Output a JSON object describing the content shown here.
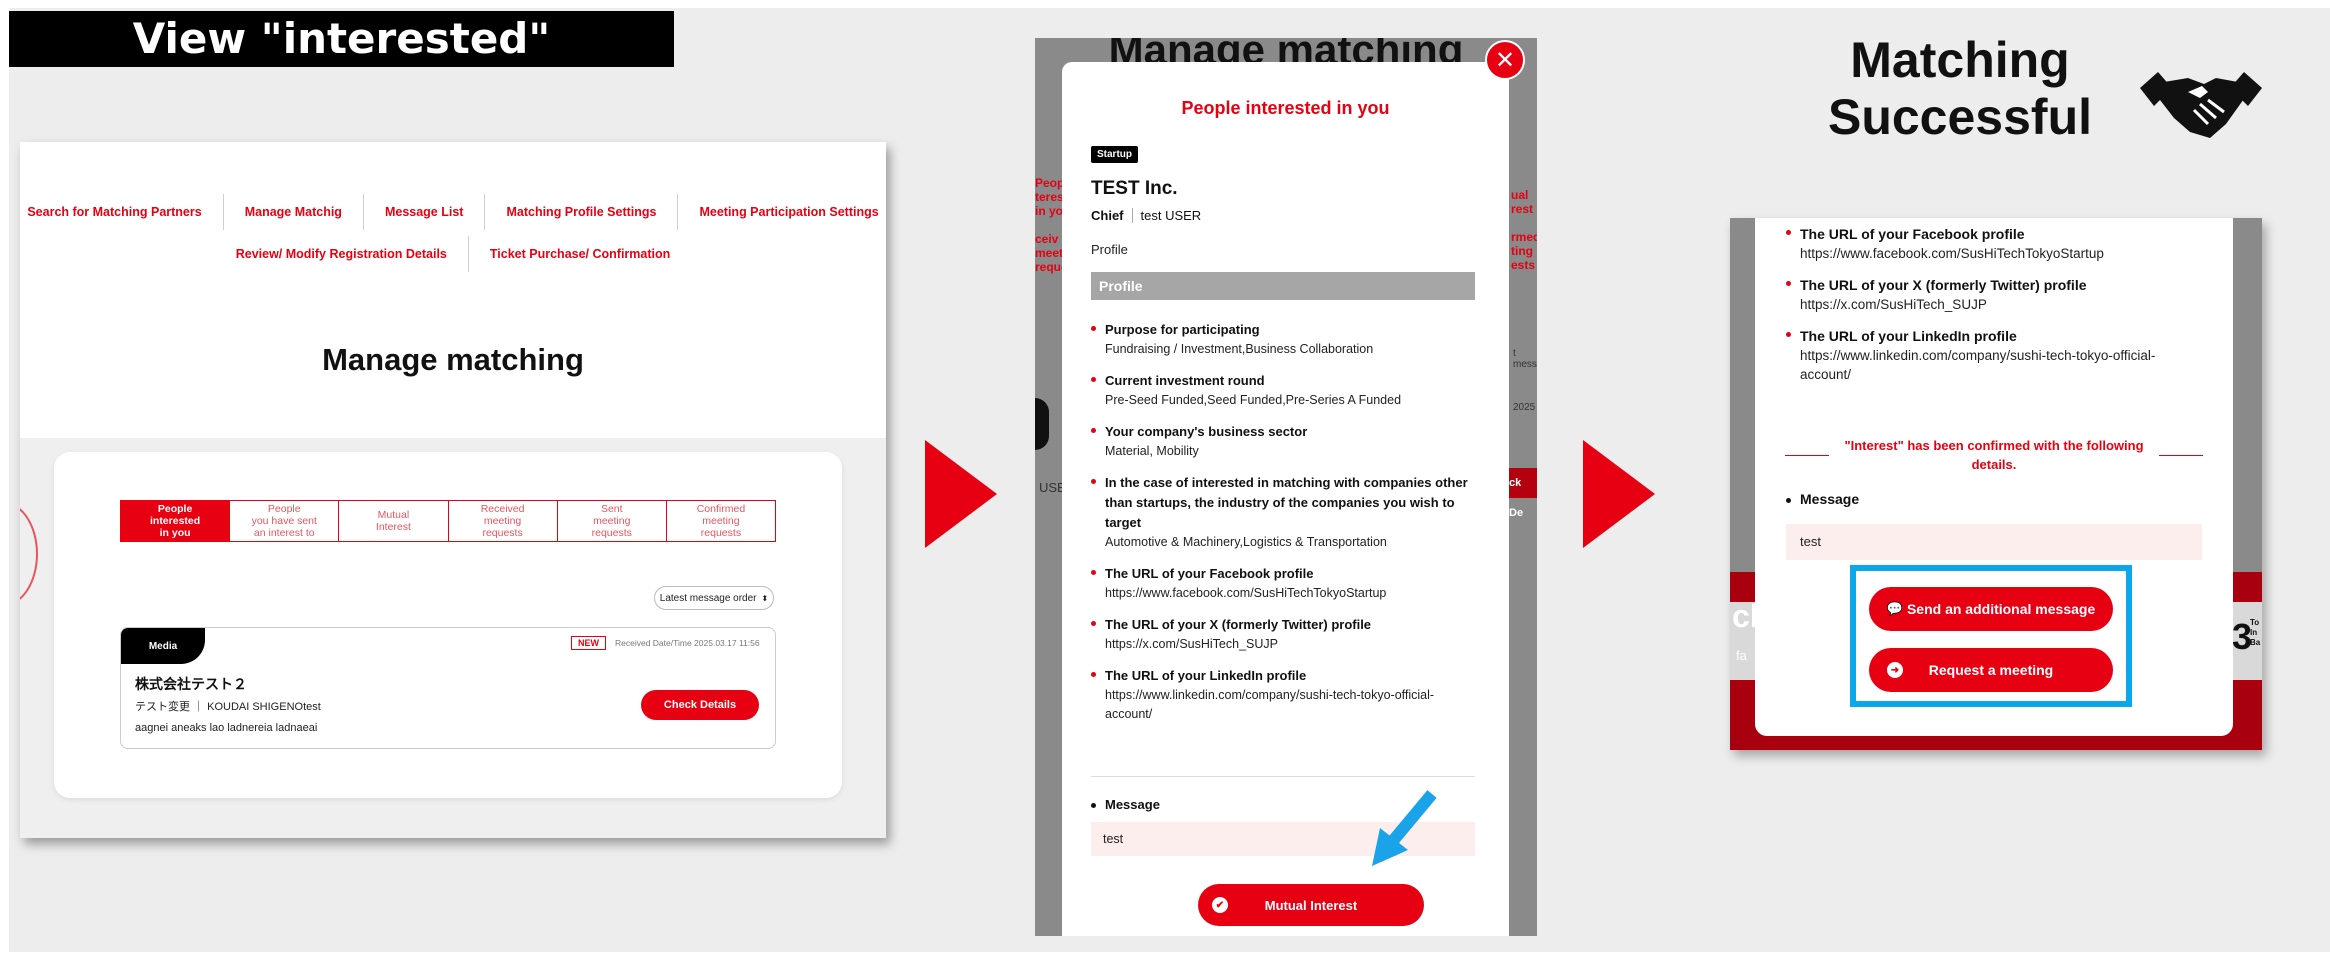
{
  "headline": "View \"interested\"",
  "panel1": {
    "nav_row1": [
      "Search for Matching Partners",
      "Manage Matchig",
      "Message List",
      "Matching Profile Settings",
      "Meeting Participation Settings"
    ],
    "nav_row2": [
      "Review/ Modify Registration Details",
      "Ticket Purchase/ Confirmation"
    ],
    "page_title": "Manage matching",
    "tabs": [
      {
        "label": "People\ninterested\nin you",
        "active": true
      },
      {
        "label": "People\nyou have sent\nan interest to",
        "active": false
      },
      {
        "label": "Mutual\nInterest",
        "active": false
      },
      {
        "label": "Received\nmeeting\nrequests",
        "active": false
      },
      {
        "label": "Sent\nmeeting\nrequests",
        "active": false
      },
      {
        "label": "Confirmed\nmeeting\nrequests",
        "active": false
      }
    ],
    "sort_label": "Latest message order",
    "card": {
      "tag": "Media",
      "badge": "NEW",
      "received": "Received Date/Time  2025.03.17 11:56",
      "company": "株式会社テスト２",
      "person": "テスト変更 ｜ KOUDAI SHIGENOtest",
      "description": "aagnei aneaks lao ladnereia ladnaeai",
      "button": "Check Details"
    }
  },
  "panel2": {
    "bg_title": "Manage matching",
    "bg_left_text": "Peop\nteres\nin yo\n\nceiv\nmeeti\nreque",
    "bg_right_text": "ual\nrest\n\nrmed\nting\nests",
    "bg_user": "USE",
    "bg_date": "2025",
    "bg_msg": "t mess",
    "bg_btn": "ck De",
    "close_glyph": "✕",
    "modal_title": "People interested in you",
    "tag": "Startup",
    "company": "TEST Inc.",
    "role": "Chief",
    "user": "test USER",
    "profile_link": "Profile",
    "profile_header": "Profile",
    "items": [
      {
        "label": "Purpose for participating",
        "value": "Fundraising / Investment,Business Collaboration"
      },
      {
        "label": "Current investment round",
        "value": "Pre-Seed Funded,Seed Funded,Pre-Series A Funded"
      },
      {
        "label": "Your company's business sector",
        "value": "Material, Mobility"
      },
      {
        "label": "In the case of interested in matching with companies other than startups, the industry of the companies you wish to target",
        "value": "Automotive & Machinery,Logistics & Transportation"
      },
      {
        "label": "The URL of your Facebook profile",
        "value": "https://www.facebook.com/SusHiTechTokyoStartup"
      },
      {
        "label": "The URL of your X (formerly Twitter) profile",
        "value": "https://x.com/SusHiTech_SUJP"
      },
      {
        "label": "The URL of your LinkedIn profile",
        "value": "https://www.linkedin.com/company/sushi-tech-tokyo-official-account/"
      }
    ],
    "message_label": "Message",
    "message_value": "test",
    "button": "Mutual Interest"
  },
  "panel3": {
    "title": "Matching\nSuccessful",
    "items": [
      {
        "label": "The URL of your Facebook profile",
        "value": "https://www.facebook.com/SusHiTechTokyoStartup"
      },
      {
        "label": "The URL of your X (formerly Twitter) profile",
        "value": "https://x.com/SusHiTech_SUJP"
      },
      {
        "label": "The URL of your LinkedIn profile",
        "value": "https://www.linkedin.com/company/sushi-tech-tokyo-official-account/"
      }
    ],
    "confirm_text": "\"Interest\" has been confirmed with the following details.",
    "message_label": "Message",
    "message_value": "test",
    "btn_message": "Send an additional message",
    "btn_meeting": "Request a meeting",
    "bg_left": "ch",
    "bg_right": "3",
    "bg_small": "fa",
    "bg_tiny": "To\nIn\nBa"
  },
  "colors": {
    "brand_red": "#e60012",
    "highlight_blue": "#0aa8ea",
    "arrow_blue": "#1aa3e8"
  },
  "icons": [
    "close-icon",
    "check-circle-icon",
    "chat-bubble-icon",
    "arrow-right-circle-icon",
    "handshake-icon",
    "pointer-arrow-icon",
    "sort-icon"
  ]
}
